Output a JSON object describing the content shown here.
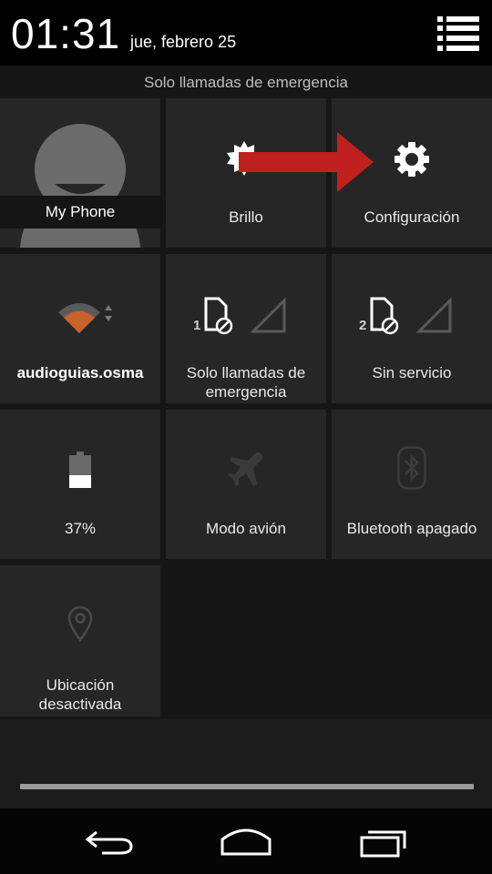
{
  "status_bar": {
    "time": "01:31",
    "date": "jue, febrero 25"
  },
  "emergency_notice": "Solo llamadas de emergencia",
  "tiles": {
    "profile": {
      "label": "My Phone",
      "icon": "avatar-icon"
    },
    "brightness": {
      "label": "Brillo",
      "icon": "brightness-icon"
    },
    "settings": {
      "label": "Configuración",
      "icon": "gear-icon"
    },
    "wifi": {
      "label": "audioguias.osma",
      "icon": "wifi-icon"
    },
    "sim1": {
      "label_line1": "Solo llamadas de",
      "label_line2": "emergencia",
      "sim_number": "1",
      "icon": "sim-blocked-icon"
    },
    "sim2": {
      "label": "Sin servicio",
      "sim_number": "2",
      "icon": "sim-blocked-icon"
    },
    "battery": {
      "label": "37%",
      "level_percent": 37,
      "icon": "battery-icon"
    },
    "airplane": {
      "label": "Modo avión",
      "icon": "airplane-icon"
    },
    "bluetooth": {
      "label": "Bluetooth apagado",
      "icon": "bluetooth-icon"
    },
    "location": {
      "label_line1": "Ubicación",
      "label_line2": "desactivada",
      "icon": "location-pin-icon"
    }
  },
  "navigation": {
    "back": "back-icon",
    "home": "home-icon",
    "recents": "recents-icon"
  },
  "colors": {
    "accent_arrow": "#c0201e",
    "wifi_orange": "#c8622a"
  }
}
